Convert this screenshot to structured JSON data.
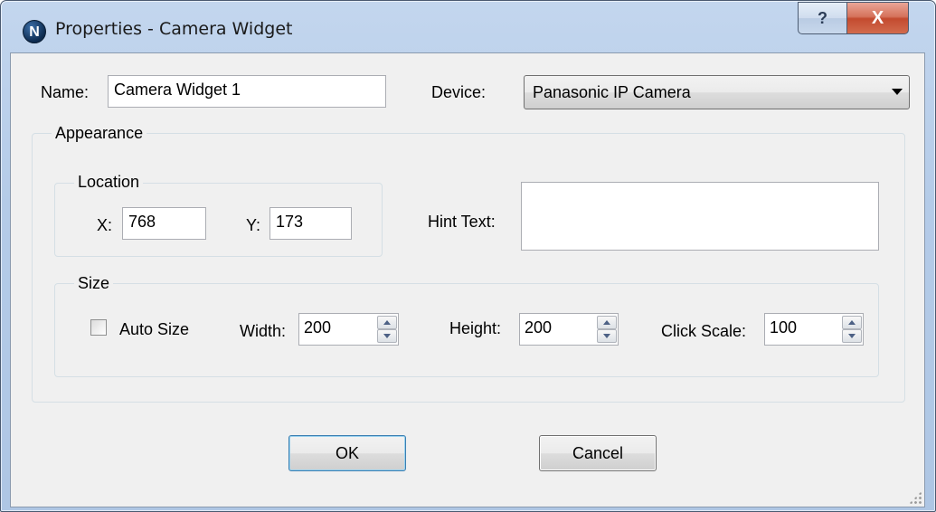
{
  "window": {
    "title": "Properties - Camera Widget",
    "logo_letter": "N",
    "help_glyph": "?",
    "close_glyph": "X"
  },
  "form": {
    "name_label": "Name:",
    "name_value": "Camera Widget 1",
    "device_label": "Device:",
    "device_value": "Panasonic IP Camera",
    "appearance_group": "Appearance",
    "location_group": "Location",
    "x_label": "X:",
    "x_value": "768",
    "y_label": "Y:",
    "y_value": "173",
    "hint_label": "Hint Text:",
    "hint_value": "",
    "size_group": "Size",
    "auto_size_label": "Auto Size",
    "auto_size_checked": false,
    "width_label": "Width:",
    "width_value": "200",
    "height_label": "Height:",
    "height_value": "200",
    "click_scale_label": "Click Scale:",
    "click_scale_value": "100"
  },
  "buttons": {
    "ok_label": "OK",
    "cancel_label": "Cancel"
  },
  "colors": {
    "titlebar": "#b4cbe8",
    "close_button": "#c34a2f",
    "dialog_background": "#f0f0f0"
  }
}
